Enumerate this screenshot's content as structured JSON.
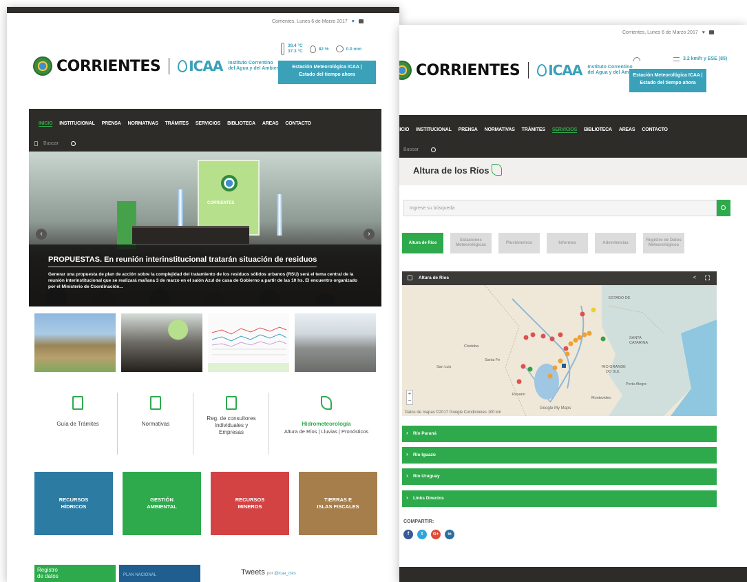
{
  "colors": {
    "green": "#2eaa4c",
    "teal": "#3aa1b9",
    "nav": "#2e2c29",
    "blue_tile": "#2b7ba3",
    "green_tile": "#2eaa4c",
    "red_tile": "#d34343",
    "brown_tile": "#a67e4c"
  },
  "left": {
    "date": "Corrientes, Lunes 6 de Marzo 2017",
    "brand": "CORRIENTES",
    "icaa": "ICAA",
    "inst_line1": "Instituto Correntino",
    "inst_line2": "del Agua y del Ambiente",
    "weather": {
      "temp_max": "38.4 °C",
      "temp_min": "37.3 °C",
      "humidity": "82 %",
      "rain": "0.0 mm"
    },
    "weather_btn_line1": "Estación Meteorológica ICAA |",
    "weather_btn_line2": "Estado del tiempo ahora",
    "nav": [
      "INICIO",
      "INSTITUCIONAL",
      "PRENSA",
      "NORMATIVAS",
      "TRÁMITES",
      "SERVICIOS",
      "BIBLIOTECA",
      "AREAS",
      "CONTACTO"
    ],
    "search_placeholder": "Buscar",
    "hero": {
      "screen_text": "CORRIENTES",
      "title": "PROPUESTAS. En reunión interinstitucional tratarán situación de residuos",
      "body": "Generar una propuesta de plan de acción sobre la complejidad del tratamiento de los residuos sólidos urbanos (RSU) será el tema central de la reunión interinstitucional que se realizará mañana 3 de marzo en el salón Azul de casa de Gobierno a partir de las 10 hs. El encuentro organizado por el Ministerio de Coordinación..."
    },
    "features": [
      {
        "icon": "document-icon",
        "label": "Guía de Trámites"
      },
      {
        "icon": "document-list-icon",
        "label": "Normativas"
      },
      {
        "icon": "register-icon",
        "label": "Reg. de consultores Individuales y Empresas"
      },
      {
        "icon": "water-map-icon",
        "title": "Hidrometeorología",
        "sub": "Altura de Ríos | Lluvias | Pronósticos"
      }
    ],
    "tiles": [
      {
        "line1": "RECURSOS",
        "line2": "HÍDRICOS"
      },
      {
        "line1": "GESTIÓN",
        "line2": "AMBIENTAL"
      },
      {
        "line1": "RECURSOS",
        "line2": "MINEROS"
      },
      {
        "line1": "TIERRAS E",
        "line2": "ISLAS FISCALES"
      }
    ],
    "registro_line1": "Registro",
    "registro_line2": "de datos",
    "plan": "PLAN NACIONAL",
    "tweets": "Tweets",
    "tweets_by": "por",
    "tweets_handle": "@icaa_ctes"
  },
  "right": {
    "date": "Corrientes, Lunes 6 de Marzo 2017",
    "brand": "CORRIENTES",
    "icaa": "ICAA",
    "inst_line1": "Instituto Correntino",
    "inst_line2": "del Agua y del Ambiente",
    "wind": "3.2 km/h y ESE (85)",
    "weather_btn_line1": "Estación Meteorológica ICAA |",
    "weather_btn_line2": "Estado del tiempo ahora",
    "nav": [
      "INICIO",
      "INSTITUCIONAL",
      "PRENSA",
      "NORMATIVAS",
      "TRÁMITES",
      "SERVICIOS",
      "BIBLIOTECA",
      "AREAS",
      "CONTACTO"
    ],
    "search_placeholder": "Buscar",
    "page_title": "Altura de los Ríos",
    "query_placeholder": "Ingrese su búsqueda",
    "tabs": [
      "Altura de Ríos",
      "Estaciones Meteorológicas",
      "Pluviómetros",
      "Informes",
      "Advertencias",
      "Registro de Datos Meteorológicos"
    ],
    "map_title": "Altura de Ríos",
    "map_labels": {
      "estado": "ESTADO DE",
      "santa": "SANTA",
      "catarina": "CATARINA",
      "rio": "RIO GRANDE",
      "dosul": "DO SUL",
      "sanluis": "San Luis",
      "cordoba": "Córdoba",
      "rosario": "Rosario",
      "montevideo": "Montevideo",
      "santafe": "Santa Fe",
      "porto": "Porto Alegre"
    },
    "map_footer": "Datos de mapas ©2017 Google   Condiciones   100 km",
    "google": "Google My Maps",
    "accordion": [
      "Río Paraná",
      "Río Iguazú",
      "Río Uruguay",
      "Links Directos"
    ],
    "share_label": "COMPARTIR:",
    "social": [
      {
        "icon": "facebook-icon",
        "glyph": "f",
        "color": "#3b5998"
      },
      {
        "icon": "twitter-icon",
        "glyph": "t",
        "color": "#2fa6d9"
      },
      {
        "icon": "googleplus-icon",
        "glyph": "G+",
        "color": "#dd4b39"
      },
      {
        "icon": "linkedin-icon",
        "glyph": "in",
        "color": "#2b6fa1"
      }
    ]
  }
}
